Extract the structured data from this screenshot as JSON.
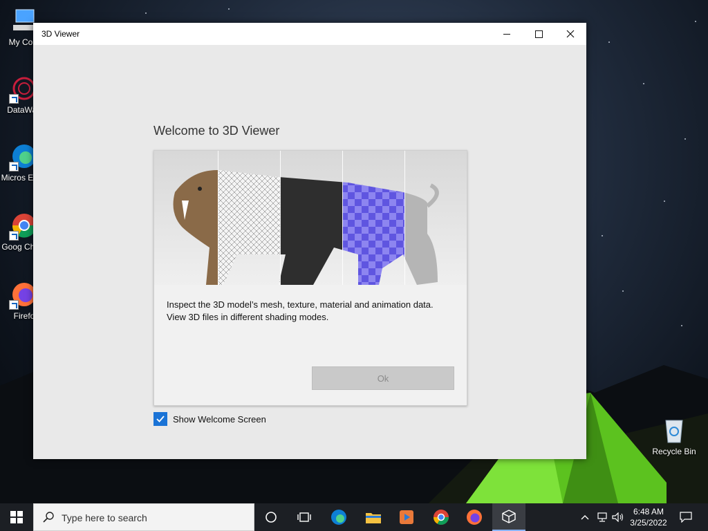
{
  "desktop": {
    "icons": [
      {
        "label": "My Com",
        "icon": "computer-icon"
      },
      {
        "label": "DataWag",
        "icon": "datawagon-icon"
      },
      {
        "label": "Micros Edge",
        "icon": "edge-icon"
      },
      {
        "label": "Goog Chron",
        "icon": "chrome-icon"
      },
      {
        "label": "Firefo",
        "icon": "firefox-icon"
      },
      {
        "label": "Recycle Bin",
        "icon": "recycle-bin-icon"
      }
    ]
  },
  "window": {
    "title": "3D Viewer",
    "controls": {
      "minimize": "minimize-icon",
      "maximize": "maximize-icon",
      "close": "close-icon"
    }
  },
  "welcome": {
    "heading": "Welcome to 3D Viewer",
    "description_line1": "Inspect the 3D model’s mesh, texture, material and animation data.",
    "description_line2": "View 3D files in different shading modes.",
    "ok_label": "Ok",
    "show_welcome_label": "Show Welcome Screen",
    "show_welcome_checked": true
  },
  "taskbar": {
    "search_placeholder": "Type here to search",
    "apps": [
      "cortana-icon",
      "task-view-icon",
      "edge-icon",
      "file-explorer-icon",
      "media-player-icon",
      "chrome-icon",
      "firefox-icon",
      "3d-viewer-icon"
    ],
    "active_app": "3d-viewer-icon",
    "time": "6:48 AM",
    "date": "3/25/2022"
  },
  "colors": {
    "accent": "#1a73d6",
    "checker_blue": "#6f66e8",
    "tent_green": "#6fd12d"
  }
}
